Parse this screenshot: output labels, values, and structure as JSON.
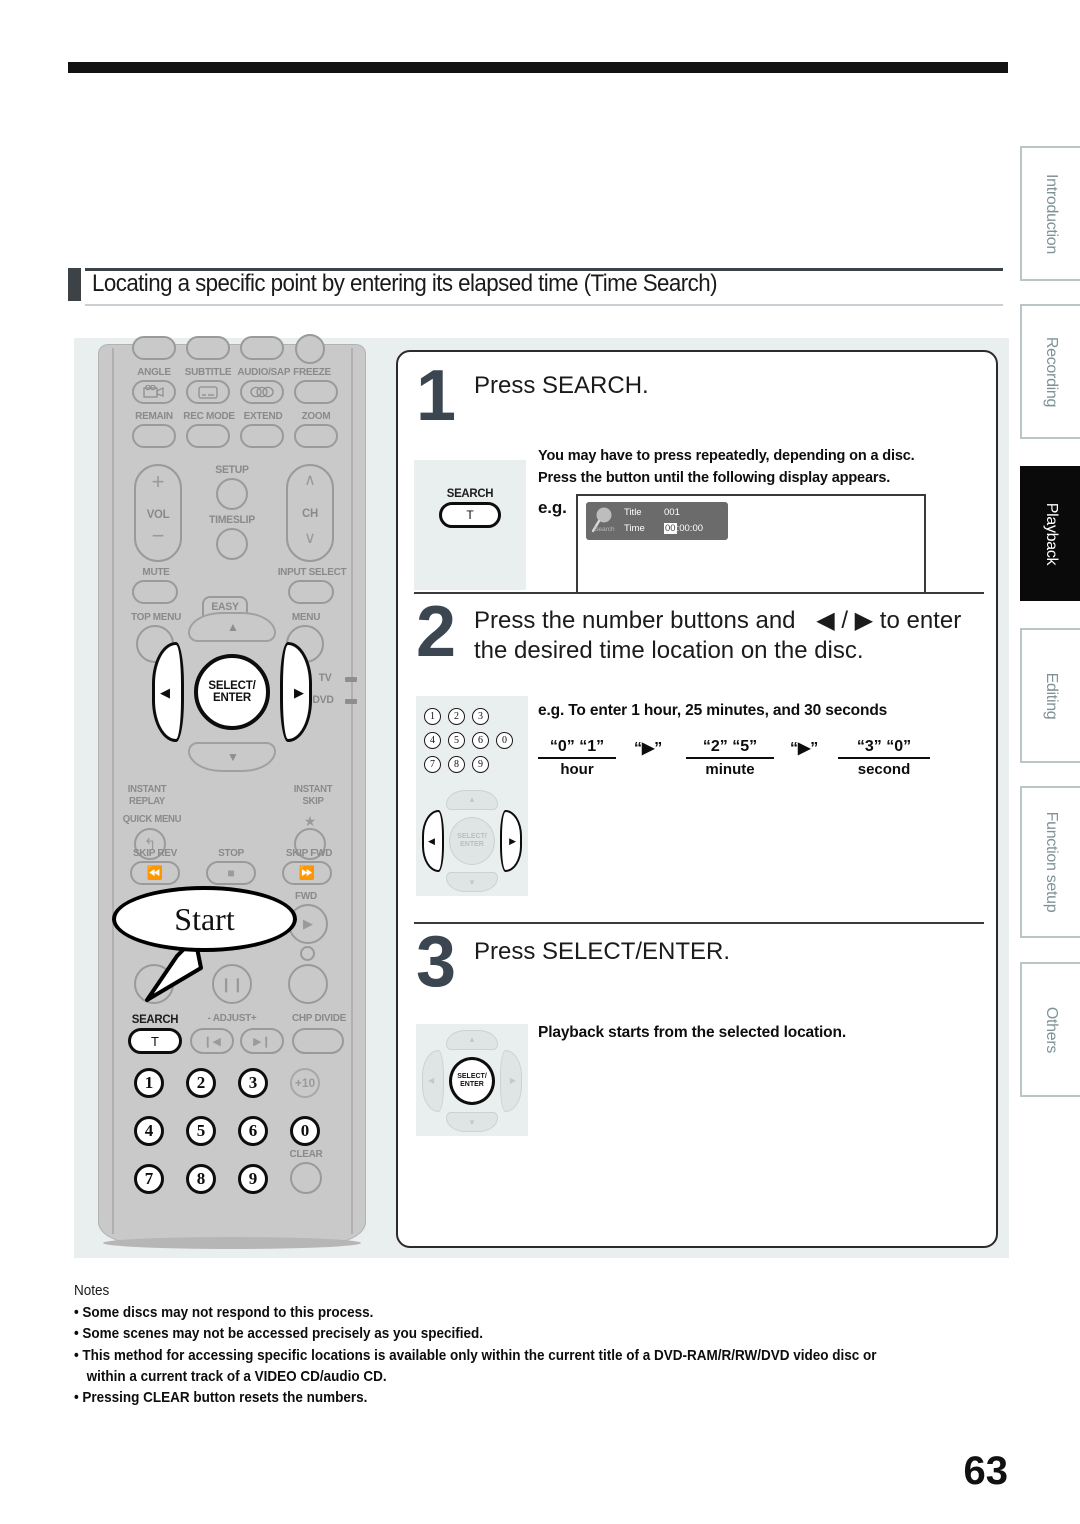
{
  "section": {
    "title": "Locating a specific point by entering its elapsed time (Time Search)"
  },
  "page_number": "63",
  "side_tabs": [
    {
      "label": "Introduction",
      "active": false
    },
    {
      "label": "Recording",
      "active": false
    },
    {
      "label": "Playback",
      "active": true
    },
    {
      "label": "Editing",
      "active": false
    },
    {
      "label": "Function setup",
      "active": false
    },
    {
      "label": "Others",
      "active": false
    }
  ],
  "remote": {
    "callout": "Start",
    "labels": {
      "angle": "ANGLE",
      "subtitle": "SUBTITLE",
      "audio_sap": "AUDIO/SAP",
      "freeze": "FREEZE",
      "remain": "REMAIN",
      "rec_mode": "REC MODE",
      "extend": "EXTEND",
      "zoom": "ZOOM",
      "vol": "VOL",
      "vol_plus": "+",
      "vol_minus": "–",
      "setup": "SETUP",
      "timeslip": "TIMESLIP",
      "ch": "CH",
      "ch_up": "∧",
      "ch_down": "∨",
      "mute": "MUTE",
      "input_select": "INPUT SELECT",
      "top_menu": "TOP MENU",
      "easy_navi": "EASY\nNAVI",
      "menu": "MENU",
      "tv": "TV",
      "dvd": "DVD",
      "select_enter": "SELECT/\nENTER",
      "instant_replay": "INSTANT\nREPLAY",
      "quick_menu": "QUICK MENU",
      "instant_skip": "INSTANT\nSKIP",
      "skip_rev": "SKIP REV",
      "stop": "STOP",
      "skip_fwd": "SKIP FWD",
      "fwd": "FWD",
      "search": "SEARCH",
      "search_key": "T",
      "adjust": "- ADJUST+",
      "chp_divide": "CHP DIVIDE",
      "plus10": "+10",
      "clear": "CLEAR"
    },
    "number_keys": [
      "1",
      "2",
      "3",
      "4",
      "5",
      "6",
      "0",
      "7",
      "8",
      "9"
    ]
  },
  "steps": [
    {
      "number": "1",
      "heading": "Press SEARCH.",
      "notes": [
        "You may have to press repeatedly, depending on a disc.",
        "Press the button until the following display appears."
      ],
      "eg_label": "e.g.",
      "key_label": "SEARCH",
      "key_glyph": "T",
      "osd": {
        "icon_label": "Search",
        "title_label": "Title",
        "title_value": "001",
        "time_label": "Time",
        "time_hour": "00",
        "time_minute": "00",
        "time_second": "00"
      }
    },
    {
      "number": "2",
      "heading_line1": "Press the number buttons and",
      "heading_arrows": "◀ / ▶",
      "heading_line1_end": "to enter",
      "heading_line2": "the desired time location on the disc.",
      "eg_heading": "e.g. To enter 1 hour, 25 minutes, and 30 seconds",
      "sequence": [
        {
          "values": "“0”   “1”",
          "label": "hour"
        },
        {
          "values": "“2”   “5”",
          "label": "minute"
        },
        {
          "values": "“3”   “0”",
          "label": "second"
        }
      ],
      "arrow_step": "“▶”",
      "keypad": [
        "1",
        "2",
        "3",
        "4",
        "5",
        "6",
        "0",
        "7",
        "8",
        "9"
      ],
      "dpad_center": "SELECT/\nENTER"
    },
    {
      "number": "3",
      "heading": "Press SELECT/ENTER.",
      "note": "Playback starts from the selected location.",
      "dpad_center": "SELECT/\nENTER"
    }
  ],
  "notes": {
    "title": "Notes",
    "items": [
      "Some discs may not respond to this process.",
      "Some scenes may not be accessed precisely as you specified.",
      "This method for accessing specific locations is available only within the current title of a DVD-RAM/R/RW/DVD video disc or",
      "within a current track of a VIDEO CD/audio CD.",
      "Pressing CLEAR button resets the numbers."
    ]
  }
}
